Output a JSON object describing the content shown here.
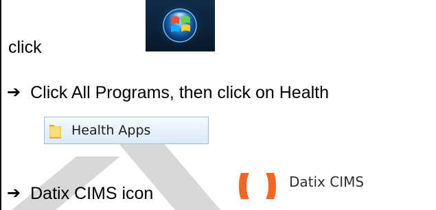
{
  "instructions": {
    "step1_text": "click",
    "step2": {
      "arrow_glyph": "➔",
      "text": "Click All Programs, then click on Health"
    },
    "step3": {
      "arrow_glyph": "➔",
      "text": "Datix CIMS icon"
    }
  },
  "items": {
    "health_apps_label": "Health Apps",
    "datix_label": "Datix CIMS"
  },
  "icons": {
    "start": "windows-start-orb-icon",
    "folder": "folder-icon",
    "datix": "datix-cims-icon"
  },
  "colors": {
    "start_background": "#0c2239",
    "health_chip_background": "#e8f1fb",
    "health_chip_border": "#9fbddc",
    "datix_orange": "#f26522",
    "watermark": "#d8d8d8"
  }
}
